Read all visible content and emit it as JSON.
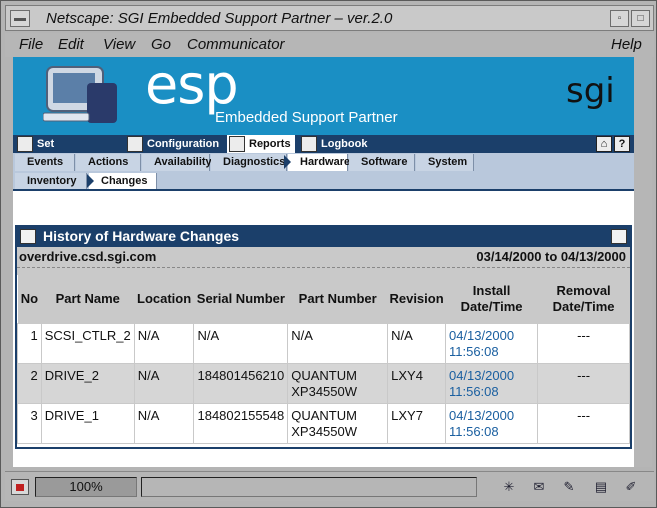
{
  "window": {
    "title": "Netscape: SGI Embedded Support Partner – ver.2.0",
    "minimize_glyph": "▫",
    "maximize_glyph": "□"
  },
  "menu": {
    "file": "File",
    "edit": "Edit",
    "view": "View",
    "go": "Go",
    "communicator": "Communicator",
    "help": "Help"
  },
  "banner": {
    "logo_text": "esp",
    "subtitle": "Embedded Support Partner",
    "brand": "sgi",
    "bg_color": "#1a8fc4"
  },
  "topnav": {
    "items": [
      {
        "label": "Set Environment",
        "icon": "wrench-icon"
      },
      {
        "label": "Configuration",
        "icon": "checkmark-icon"
      },
      {
        "label": "Reports",
        "icon": "report-table-icon",
        "active": true
      },
      {
        "label": "Logbook",
        "icon": "logbook-icon"
      }
    ],
    "home_glyph": "⌂",
    "help_glyph": "?"
  },
  "tabs": [
    "Events",
    "Actions",
    "Availability",
    "Diagnostics",
    "Hardware",
    "Software",
    "System"
  ],
  "active_tab": "Hardware",
  "subtabs": [
    "Inventory",
    "Changes"
  ],
  "active_subtab": "Changes",
  "panel": {
    "title": "History of Hardware Changes",
    "host": "overdrive.csd.sgi.com",
    "date_range": "03/14/2000 to 04/13/2000",
    "accent": "#1b3f6a"
  },
  "table": {
    "headers": {
      "no": "No",
      "part_name": "Part Name",
      "location": "Location",
      "serial": "Serial Number",
      "part_number": "Part Number",
      "revision": "Revision",
      "install_1": "Install",
      "install_2": "Date/Time",
      "removal_1": "Removal",
      "removal_2": "Date/Time"
    },
    "rows": [
      {
        "no": "1",
        "part_name": "SCSI_CTLR_2",
        "location": "N/A",
        "serial": "N/A",
        "part_number_1": "N/A",
        "part_number_2": "",
        "revision": "N/A",
        "install_date": "04/13/2000",
        "install_time": "11:56:08",
        "removal": "---"
      },
      {
        "no": "2",
        "part_name": "DRIVE_2",
        "location": "N/A",
        "serial": "184801456210",
        "part_number_1": "QUANTUM",
        "part_number_2": "XP34550W",
        "revision": "LXY4",
        "install_date": "04/13/2000",
        "install_time": "11:56:08",
        "removal": "---"
      },
      {
        "no": "3",
        "part_name": "DRIVE_1",
        "location": "N/A",
        "serial": "184802155548",
        "part_number_1": "QUANTUM",
        "part_number_2": "XP34550W",
        "revision": "LXY7",
        "install_date": "04/13/2000",
        "install_time": "11:56:08",
        "removal": "---"
      }
    ]
  },
  "statusbar": {
    "progress": "100%",
    "icons": [
      "navigator-icon",
      "mail-icon",
      "discussions-icon",
      "composer-icon",
      "edit-icon"
    ]
  }
}
